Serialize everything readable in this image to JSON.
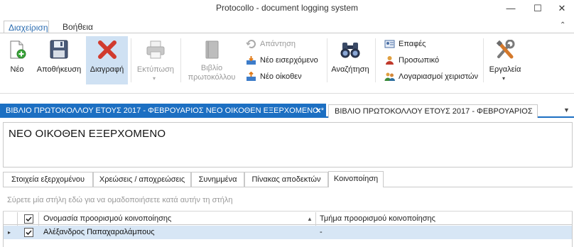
{
  "window": {
    "title": "Protocollo - document logging system",
    "minimize": "—",
    "maximize": "☐",
    "close": "✕"
  },
  "ribbon_tabs": [
    "Διαχείριση",
    "Βοήθεια"
  ],
  "ribbon": {
    "new": "Νέο",
    "save": "Αποθήκευση",
    "delete": "Διαγραφή",
    "print": "Εκτύπωση",
    "book_line1": "Βιβλίο",
    "book_line2": "πρωτοκόλλου",
    "reply": "Απάντηση",
    "new_incoming": "Νέο εισερχόμενο",
    "new_outgoing": "Νέο οίκοθεν",
    "search": "Αναζήτηση",
    "contacts": "Επαφές",
    "staff": "Προσωπικό",
    "user_accounts": "Λογαριασμοί χειριστών",
    "tools": "Εργαλεία"
  },
  "doc_tabs": [
    "ΒΙΒΛΙΟ ΠΡΩΤΟΚΟΛΛΟΥ ΕΤΟΥΣ 2017 - ΦΕΒΡΟΥΑΡΙΟΣ  ΝΕΟ ΟΙΚΟΘΕΝ ΕΞΕΡΧΟΜΕΝΟ *",
    "ΒΙΒΛΙΟ ΠΡΩΤΟΚΟΛΛΟΥ ΕΤΟΥΣ 2017 - ΦΕΒΡΟΥΑΡΙΟΣ"
  ],
  "doc_title": "ΝΕΟ ΟΙΚΟΘΕΝ ΕΞΕΡΧΟΜΕΝΟ",
  "sub_tabs": [
    "Στοιχεία εξερχομένου",
    "Χρεώσεις  / αποχρεώσεις",
    "Συνημμένα",
    "Πίνακας αποδεκτών",
    "Κοινοποίηση"
  ],
  "sub_tab_active": "Κοινοποίηση",
  "grid": {
    "group_hint": "Σύρετε μία στήλη εδώ για να ομαδοποιήσετε κατά αυτήν τη στήλη",
    "columns": [
      "Ονομασία προορισμού κοινοποίησης",
      "Τμήμα προορισμού κοινοποίησης"
    ],
    "rows": [
      {
        "checked": true,
        "name": "Αλέξανδρος Παπαχαραλάμπους",
        "department": "-"
      }
    ]
  },
  "colors": {
    "accent": "#1c6fc2",
    "row_selected": "#d7e6f5",
    "ribbon_tab_active": "#2b6cb0"
  }
}
